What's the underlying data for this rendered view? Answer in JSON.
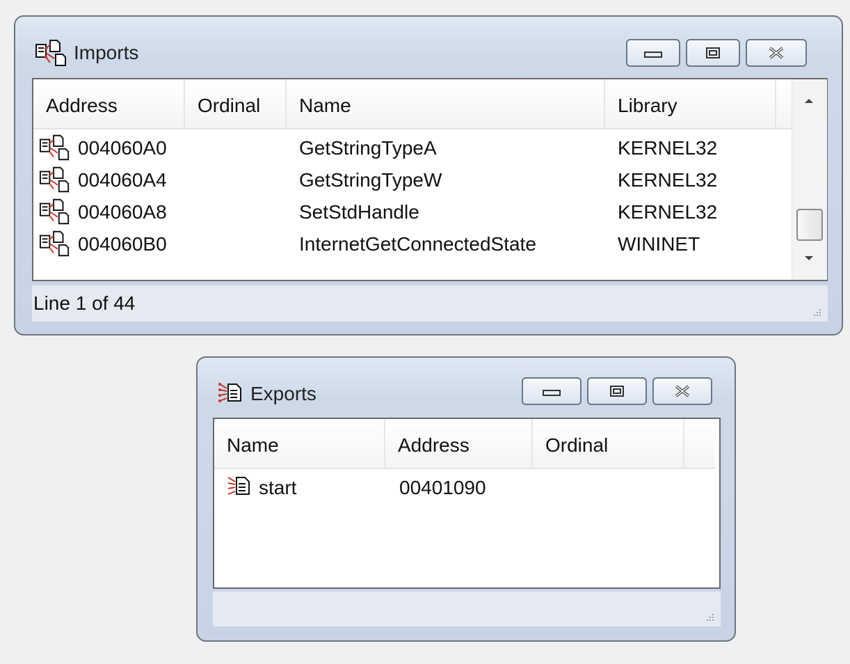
{
  "imports": {
    "title": "Imports",
    "title_icon": "imports-icon",
    "columns": [
      "Address",
      "Ordinal",
      "Name",
      "Library"
    ],
    "rows": [
      {
        "address": "004060A0",
        "ordinal": "",
        "name": "GetStringTypeA",
        "library": "KERNEL32"
      },
      {
        "address": "004060A4",
        "ordinal": "",
        "name": "GetStringTypeW",
        "library": "KERNEL32"
      },
      {
        "address": "004060A8",
        "ordinal": "",
        "name": "SetStdHandle",
        "library": "KERNEL32"
      },
      {
        "address": "004060B0",
        "ordinal": "",
        "name": "InternetGetConnectedState",
        "library": "WININET"
      }
    ],
    "status": "Line 1 of 44"
  },
  "exports": {
    "title": "Exports",
    "title_icon": "exports-icon",
    "columns": [
      "Name",
      "Address",
      "Ordinal"
    ],
    "rows": [
      {
        "name": "start",
        "address": "00401090",
        "ordinal": ""
      }
    ],
    "status": ""
  },
  "window_buttons": [
    "minimize-icon",
    "maximize-icon",
    "close-icon"
  ],
  "colors": {
    "icon_red": "#c0392b",
    "frame": "#6d7480",
    "title_bg": "#d3deec"
  }
}
